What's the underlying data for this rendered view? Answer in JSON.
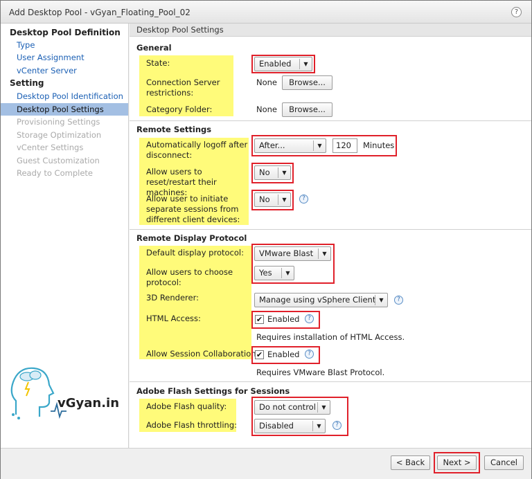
{
  "window": {
    "title": "Add Desktop Pool - vGyan_Floating_Pool_02",
    "help": "?"
  },
  "sidebar": {
    "section1": "Desktop Pool Definition",
    "items1": [
      "Type",
      "User Assignment",
      "vCenter Server"
    ],
    "section2": "Setting",
    "items2": [
      "Desktop Pool Identification",
      "Desktop Pool Settings",
      "Provisioning Settings",
      "Storage Optimization",
      "vCenter Settings",
      "Guest Customization",
      "Ready to Complete"
    ],
    "selected": "Desktop Pool Settings"
  },
  "logo": {
    "text": "vGyan.in"
  },
  "content": {
    "header": "Desktop Pool Settings",
    "general": {
      "title": "General",
      "state_label": "State:",
      "state_value": "Enabled",
      "conn_label": "Connection Server restrictions:",
      "conn_value": "None",
      "conn_browse": "Browse...",
      "cat_label": "Category Folder:",
      "cat_value": "None",
      "cat_browse": "Browse..."
    },
    "remote": {
      "title": "Remote Settings",
      "logoff_label": "Automatically logoff after disconnect:",
      "logoff_value": "After...",
      "logoff_minutes": "120",
      "minutes_label": "Minutes",
      "reset_label": "Allow users to reset/restart their machines:",
      "reset_value": "No",
      "sessions_label": "Allow user to initiate separate sessions from different client devices:",
      "sessions_value": "No"
    },
    "display": {
      "title": "Remote Display Protocol",
      "default_label": "Default display protocol:",
      "default_value": "VMware Blast",
      "choose_label": "Allow users to choose protocol:",
      "choose_value": "Yes",
      "renderer_label": "3D Renderer:",
      "renderer_value": "Manage using vSphere Client",
      "html_label": "HTML Access:",
      "html_check": "Enabled",
      "html_note": "Requires installation of HTML Access.",
      "collab_label": "Allow Session Collaboration:",
      "collab_check": "Enabled",
      "collab_note": "Requires VMware Blast Protocol."
    },
    "flash": {
      "title": "Adobe Flash Settings for Sessions",
      "quality_label": "Adobe Flash quality:",
      "quality_value": "Do not control",
      "throttle_label": "Adobe Flash throttling:",
      "throttle_value": "Disabled"
    }
  },
  "footer": {
    "back": "< Back",
    "next": "Next >",
    "cancel": "Cancel"
  },
  "colors": {
    "highlight": "#fffb7a",
    "annotation_red": "#e0202a",
    "selected_bg": "#a3bfe3",
    "link": "#1a5fb4"
  }
}
